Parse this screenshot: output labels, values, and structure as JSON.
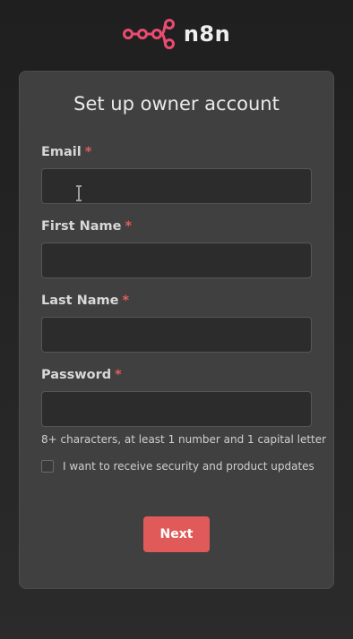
{
  "brand": {
    "name": "n8n",
    "color": "#ea4b71"
  },
  "form": {
    "title": "Set up owner account",
    "required_marker": "*",
    "fields": [
      {
        "label": "Email",
        "value": "",
        "placeholder": ""
      },
      {
        "label": "First Name",
        "value": "",
        "placeholder": ""
      },
      {
        "label": "Last Name",
        "value": "",
        "placeholder": ""
      },
      {
        "label": "Password",
        "value": "",
        "placeholder": ""
      }
    ],
    "password_hint": "8+ characters, at least 1 number and 1 capital letter",
    "updates_checkbox": {
      "label": "I want to receive security and product updates",
      "checked": false
    },
    "next_button": "Next"
  },
  "colors": {
    "accent": "#e05a5a",
    "card": "#404041",
    "background": "#262626"
  }
}
